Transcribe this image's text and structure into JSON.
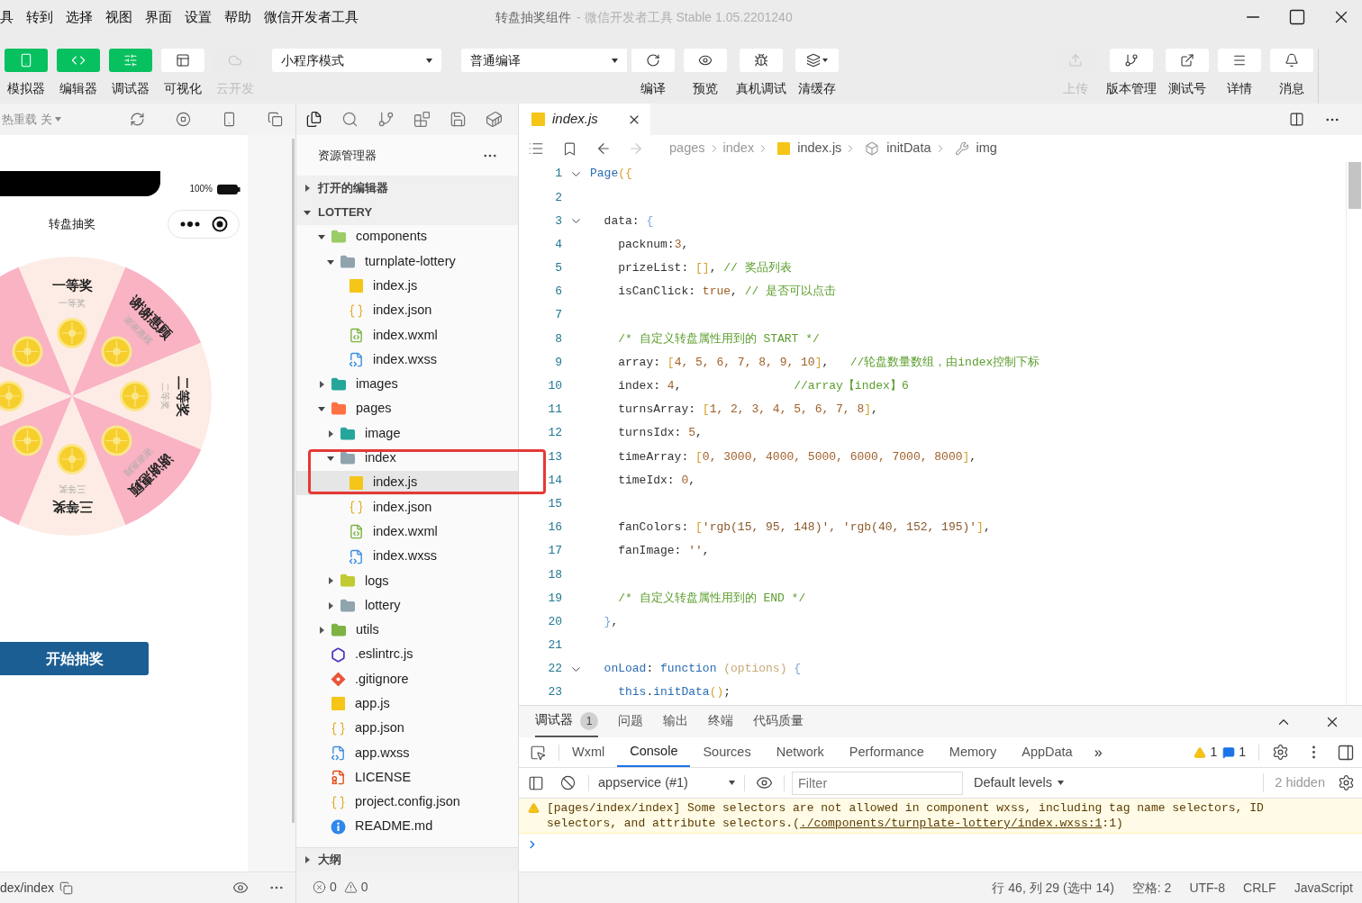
{
  "menu": [
    "具",
    "转到",
    "选择",
    "视图",
    "界面",
    "设置",
    "帮助",
    "微信开发者工具"
  ],
  "window": {
    "title": "转盘抽奖组件",
    "app": "- 微信开发者工具 Stable 1.05.2201240"
  },
  "toolbar": {
    "views": [
      {
        "label": "模拟器",
        "kind": "phone",
        "on": true,
        "disabled": false
      },
      {
        "label": "编辑器",
        "kind": "code",
        "on": true,
        "disabled": false
      },
      {
        "label": "调试器",
        "kind": "debug",
        "on": true,
        "disabled": false
      },
      {
        "label": "可视化",
        "kind": "visual",
        "on": false,
        "disabled": false
      },
      {
        "label": "云开发",
        "kind": "cloud",
        "on": false,
        "disabled": true
      }
    ],
    "mode_select": "小程序模式",
    "compile_select": "普通编译",
    "actions": [
      {
        "label": "编译",
        "kind": "compile",
        "disabled": false
      },
      {
        "label": "预览",
        "kind": "preview",
        "disabled": false
      },
      {
        "label": "真机调试",
        "kind": "device",
        "disabled": false
      },
      {
        "label": "清缓存",
        "kind": "cache",
        "disabled": false
      }
    ],
    "services": [
      {
        "label": "上传",
        "kind": "upload",
        "disabled": true
      },
      {
        "label": "版本管理",
        "kind": "version",
        "disabled": false
      },
      {
        "label": "测试号",
        "kind": "test",
        "disabled": false
      },
      {
        "label": "详情",
        "kind": "details",
        "disabled": false
      },
      {
        "label": "消息",
        "kind": "messages",
        "disabled": false
      }
    ]
  },
  "simulator": {
    "hot_reload": "热重载 关",
    "battery": "100%",
    "page_title": "转盘抽奖",
    "segments": [
      {
        "kind": "prize",
        "label": "一等奖",
        "sub": "一等奖"
      },
      {
        "kind": "thanks",
        "label": "谢谢惠顾",
        "sub": "谢谢惠顾"
      },
      {
        "kind": "prize",
        "label": "二等奖",
        "sub": "二等奖"
      },
      {
        "kind": "thanks",
        "label": "谢谢惠顾",
        "sub": "谢谢惠顾"
      },
      {
        "kind": "prize",
        "label": "三等奖",
        "sub": "三等奖"
      },
      {
        "kind": "thanks"
      },
      {
        "kind": "prize"
      },
      {
        "kind": "thanks"
      }
    ],
    "start_button": "开始抽奖",
    "path": "dex/index"
  },
  "explorer": {
    "title": "资源管理器",
    "sections": [
      {
        "label": "打开的编辑器",
        "expanded": false
      },
      {
        "label": "LOTTERY",
        "expanded": true
      }
    ],
    "tree": [
      {
        "name": "components",
        "kind": "folder",
        "color": "#9ccc65",
        "expanded": true,
        "selected": false,
        "children": [
          {
            "name": "turnplate-lottery",
            "kind": "folder",
            "color": "#90a4ae",
            "expanded": true,
            "selected": false,
            "children": [
              {
                "name": "index.js",
                "kind": "js",
                "selected": false
              },
              {
                "name": "index.json",
                "kind": "json",
                "selected": false
              },
              {
                "name": "index.wxml",
                "kind": "wxml",
                "selected": false
              },
              {
                "name": "index.wxss",
                "kind": "wxss",
                "selected": false
              }
            ]
          }
        ]
      },
      {
        "name": "images",
        "kind": "folder",
        "color": "#26a69a",
        "expanded": false,
        "selected": false
      },
      {
        "name": "pages",
        "kind": "folder",
        "color": "#ff7043",
        "expanded": true,
        "selected": false,
        "children": [
          {
            "name": "image",
            "kind": "folder",
            "color": "#26a69a",
            "expanded": false,
            "selected": false
          },
          {
            "name": "index",
            "kind": "folder",
            "color": "#90a4ae",
            "expanded": true,
            "selected": false,
            "children": [
              {
                "name": "index.js",
                "kind": "js",
                "selected": true
              },
              {
                "name": "index.json",
                "kind": "json",
                "selected": false
              },
              {
                "name": "index.wxml",
                "kind": "wxml",
                "selected": false
              },
              {
                "name": "index.wxss",
                "kind": "wxss",
                "selected": false
              }
            ]
          },
          {
            "name": "logs",
            "kind": "folder",
            "color": "#c0ca33",
            "expanded": false,
            "selected": false
          },
          {
            "name": "lottery",
            "kind": "folder",
            "color": "#90a4ae",
            "expanded": false,
            "selected": false
          }
        ]
      },
      {
        "name": "utils",
        "kind": "folder",
        "color": "#7cb342",
        "expanded": false,
        "selected": false
      },
      {
        "name": ".eslintrc.js",
        "kind": "eslint",
        "selected": false
      },
      {
        "name": ".gitignore",
        "kind": "git",
        "selected": false
      },
      {
        "name": "app.js",
        "kind": "js",
        "selected": false
      },
      {
        "name": "app.json",
        "kind": "json",
        "selected": false
      },
      {
        "name": "app.wxss",
        "kind": "wxss",
        "selected": false
      },
      {
        "name": "LICENSE",
        "kind": "license",
        "selected": false
      },
      {
        "name": "project.config.json",
        "kind": "json",
        "selected": false
      },
      {
        "name": "README.md",
        "kind": "info",
        "selected": false
      }
    ],
    "outline": {
      "label": "大纲",
      "expanded": false
    },
    "errors": "0",
    "warnings": "0"
  },
  "editor": {
    "tabs": [
      {
        "label": "index.js",
        "selected": true
      }
    ],
    "breadcrumb": [
      {
        "label": "pages",
        "kind": "folder"
      },
      {
        "label": "index",
        "kind": "folder"
      },
      {
        "label": "index.js",
        "kind": "js"
      },
      {
        "label": "initData",
        "kind": "method"
      },
      {
        "label": "img",
        "kind": "property"
      }
    ],
    "lines": [
      {
        "number": "1",
        "fold": true,
        "tokens": [
          {
            "kind": "fn",
            "text": "Page"
          },
          {
            "kind": "bracket",
            "text": "({"
          }
        ]
      },
      {
        "number": "2",
        "fold": false
      },
      {
        "number": "3",
        "fold": true,
        "tokens": [
          {
            "kind": "plain",
            "text": "  data: "
          },
          {
            "kind": "brace",
            "text": "{"
          }
        ]
      },
      {
        "number": "4",
        "fold": false,
        "tokens": [
          {
            "kind": "plain",
            "text": "    packnum:"
          },
          {
            "kind": "number",
            "text": "3"
          },
          {
            "kind": "plain",
            "text": ","
          }
        ]
      },
      {
        "number": "5",
        "fold": false,
        "tokens": [
          {
            "kind": "plain",
            "text": "    prizeList: "
          },
          {
            "kind": "bracket",
            "text": "[]"
          },
          {
            "kind": "plain",
            "text": ", "
          },
          {
            "kind": "comment",
            "text": "// 奖品列表"
          }
        ]
      },
      {
        "number": "6",
        "fold": false,
        "tokens": [
          {
            "kind": "plain",
            "text": "    isCanClick: "
          },
          {
            "kind": "number",
            "text": "true"
          },
          {
            "kind": "plain",
            "text": ", "
          },
          {
            "kind": "comment",
            "text": "// 是否可以点击"
          }
        ]
      },
      {
        "number": "7",
        "fold": false
      },
      {
        "number": "8",
        "fold": false,
        "tokens": [
          {
            "kind": "comment",
            "text": "    /* 自定义转盘属性用到的 START */"
          }
        ]
      },
      {
        "number": "9",
        "fold": false,
        "tokens": [
          {
            "kind": "plain",
            "text": "    array: "
          },
          {
            "kind": "bracket",
            "text": "["
          },
          {
            "kind": "number",
            "text": "4, 5, 6, 7, 8, 9, 10"
          },
          {
            "kind": "bracket",
            "text": "]"
          },
          {
            "kind": "plain",
            "text": ",   "
          },
          {
            "kind": "comment",
            "text": "//轮盘数量数组，由index控制下标"
          }
        ]
      },
      {
        "number": "10",
        "fold": false,
        "tokens": [
          {
            "kind": "plain",
            "text": "    index: "
          },
          {
            "kind": "number",
            "text": "4"
          },
          {
            "kind": "plain",
            "text": ",                "
          },
          {
            "kind": "comment",
            "text": "//array【index】6"
          }
        ]
      },
      {
        "number": "11",
        "fold": false,
        "tokens": [
          {
            "kind": "plain",
            "text": "    turnsArray: "
          },
          {
            "kind": "bracket",
            "text": "["
          },
          {
            "kind": "number",
            "text": "1, 2, 3, 4, 5, 6, 7, 8"
          },
          {
            "kind": "bracket",
            "text": "]"
          },
          {
            "kind": "plain",
            "text": ","
          }
        ]
      },
      {
        "number": "12",
        "fold": false,
        "tokens": [
          {
            "kind": "plain",
            "text": "    turnsIdx: "
          },
          {
            "kind": "number",
            "text": "5"
          },
          {
            "kind": "plain",
            "text": ","
          }
        ]
      },
      {
        "number": "13",
        "fold": false,
        "tokens": [
          {
            "kind": "plain",
            "text": "    timeArray: "
          },
          {
            "kind": "bracket",
            "text": "["
          },
          {
            "kind": "number",
            "text": "0, 3000, 4000, 5000, 6000, 7000, 8000"
          },
          {
            "kind": "bracket",
            "text": "]"
          },
          {
            "kind": "plain",
            "text": ","
          }
        ]
      },
      {
        "number": "14",
        "fold": false,
        "tokens": [
          {
            "kind": "plain",
            "text": "    timeIdx: "
          },
          {
            "kind": "number",
            "text": "0"
          },
          {
            "kind": "plain",
            "text": ","
          }
        ]
      },
      {
        "number": "15",
        "fold": false
      },
      {
        "number": "16",
        "fold": false,
        "tokens": [
          {
            "kind": "plain",
            "text": "    fanColors: "
          },
          {
            "kind": "bracket",
            "text": "["
          },
          {
            "kind": "string",
            "text": "'rgb(15, 95, 148)', 'rgb(40, 152, 195)'"
          },
          {
            "kind": "bracket",
            "text": "]"
          },
          {
            "kind": "plain",
            "text": ","
          }
        ]
      },
      {
        "number": "17",
        "fold": false,
        "tokens": [
          {
            "kind": "plain",
            "text": "    fanImage: "
          },
          {
            "kind": "string",
            "text": "''"
          },
          {
            "kind": "plain",
            "text": ","
          }
        ]
      },
      {
        "number": "18",
        "fold": false
      },
      {
        "number": "19",
        "fold": false,
        "tokens": [
          {
            "kind": "comment",
            "text": "    /* 自定义转盘属性用到的 END */"
          }
        ]
      },
      {
        "number": "20",
        "fold": false,
        "tokens": [
          {
            "kind": "brace",
            "text": "  }"
          },
          {
            "kind": "plain",
            "text": ","
          }
        ]
      },
      {
        "number": "21",
        "fold": false
      },
      {
        "number": "22",
        "fold": true,
        "tokens": [
          {
            "kind": "fn",
            "text": "  onLoad"
          },
          {
            "kind": "plain",
            "text": ": "
          },
          {
            "kind": "fn",
            "text": "function "
          },
          {
            "kind": "param",
            "text": "(options) "
          },
          {
            "kind": "brace",
            "text": "{"
          }
        ]
      },
      {
        "number": "23",
        "fold": false,
        "tokens": [
          {
            "kind": "fn",
            "text": "    this"
          },
          {
            "kind": "plain",
            "text": "."
          },
          {
            "kind": "fn",
            "text": "initData"
          },
          {
            "kind": "bracket",
            "text": "()"
          },
          {
            "kind": "plain",
            "text": ";"
          }
        ]
      }
    ]
  },
  "debugger": {
    "panel_tabs": [
      {
        "label": "调试器",
        "badge": "1",
        "selected": true
      },
      {
        "label": "问题",
        "selected": false
      },
      {
        "label": "输出",
        "selected": false
      },
      {
        "label": "终端",
        "selected": false
      },
      {
        "label": "代码质量",
        "selected": false
      }
    ],
    "devtools_tabs": [
      {
        "label": "Wxml",
        "selected": false
      },
      {
        "label": "Console",
        "selected": true
      },
      {
        "label": "Sources",
        "selected": false
      },
      {
        "label": "Network",
        "selected": false
      },
      {
        "label": "Performance",
        "selected": false
      },
      {
        "label": "Memory",
        "selected": false
      },
      {
        "label": "AppData",
        "selected": false
      }
    ],
    "more_tabs": "»",
    "warnings": "1",
    "messages": "1",
    "context": "appservice (#1)",
    "filter": {
      "placeholder": "Filter"
    },
    "levels": "Default levels",
    "hidden": "2 hidden",
    "console": [
      {
        "kind": "warning",
        "text": "[pages/index/index] Some selectors are not allowed in component wxss, including tag name selectors, ID selectors, and attribute selectors.(",
        "link": "./components/turnplate-lottery/index.wxss:1",
        "suffix": ":1)"
      }
    ]
  },
  "status_bar": {
    "position": "行 46, 列 29 (选中 14)",
    "indent": "空格: 2",
    "encoding": "UTF-8",
    "eol": "CRLF",
    "language": "JavaScript"
  }
}
